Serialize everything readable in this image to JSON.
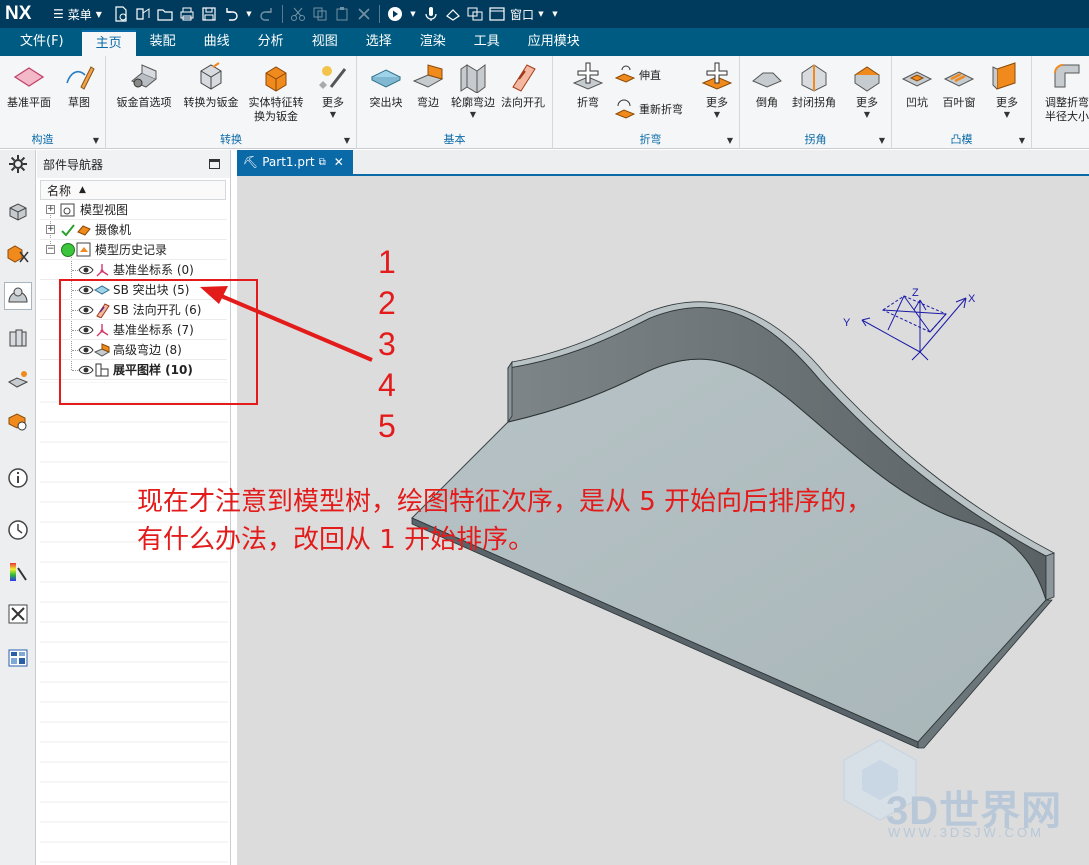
{
  "app": {
    "logo": "NX",
    "menu_label": "菜单",
    "window_label": "窗口"
  },
  "tabs": [
    {
      "label": "文件(F)"
    },
    {
      "label": "主页"
    },
    {
      "label": "装配"
    },
    {
      "label": "曲线"
    },
    {
      "label": "分析"
    },
    {
      "label": "视图"
    },
    {
      "label": "选择"
    },
    {
      "label": "渲染"
    },
    {
      "label": "工具"
    },
    {
      "label": "应用模块"
    }
  ],
  "ribbon": {
    "groups": {
      "construct": "构造",
      "convert": "转换",
      "basic": "基本",
      "bend": "折弯",
      "corner": "拐角",
      "punch": "凸模"
    },
    "buttons": {
      "datum_plane": "基准平面",
      "sketch": "草图",
      "sheetmetal_pref": "钣金首选项",
      "convert_to_sm": "转换为钣金",
      "solid_to_sm_1": "实体特征转",
      "solid_to_sm_2": "换为钣金",
      "more": "更多",
      "tab": "突出块",
      "flange": "弯边",
      "contour_flange": "轮廓弯边",
      "normal_cutout": "法向开孔",
      "fold": "折弯",
      "unbend": "伸直",
      "rebend": "重新折弯",
      "chamfer": "倒角",
      "closed_corner": "封闭拐角",
      "dimple": "凹坑",
      "louver": "百叶窗",
      "adjust_1": "调整折弯",
      "adjust_2": "半径大小"
    }
  },
  "navigator": {
    "title": "部件导航器",
    "column_name": "名称",
    "nodes": [
      {
        "label": "模型视图"
      },
      {
        "label": "摄像机"
      },
      {
        "label": "模型历史记录"
      },
      {
        "label": "基准坐标系 (0)"
      },
      {
        "label": "SB 突出块 (5)"
      },
      {
        "label": "SB 法向开孔 (6)"
      },
      {
        "label": "基准坐标系 (7)"
      },
      {
        "label": "高级弯边 (8)"
      },
      {
        "label": "展平图样 (10)"
      }
    ]
  },
  "document": {
    "tab_label": "Part1.prt"
  },
  "csys": {
    "x": "X",
    "y": "Y",
    "z": "Z"
  },
  "annotation": {
    "numbers": [
      "1",
      "2",
      "3",
      "4",
      "5"
    ],
    "line1": "现在才注意到模型树，绘图特征次序，是从 5 开始向后排序的，",
    "line2": "有什么办法，改回从 1 开始排序。"
  },
  "watermark": {
    "brand": "3D世界网",
    "url": "WWW.3DSJW.COM"
  },
  "colors": {
    "titlebar": "#003a5c",
    "tabbar": "#005b82",
    "accent": "#0a6aa8",
    "annotation": "#e31b1b",
    "viewport_bg": "#dcdcdc"
  }
}
